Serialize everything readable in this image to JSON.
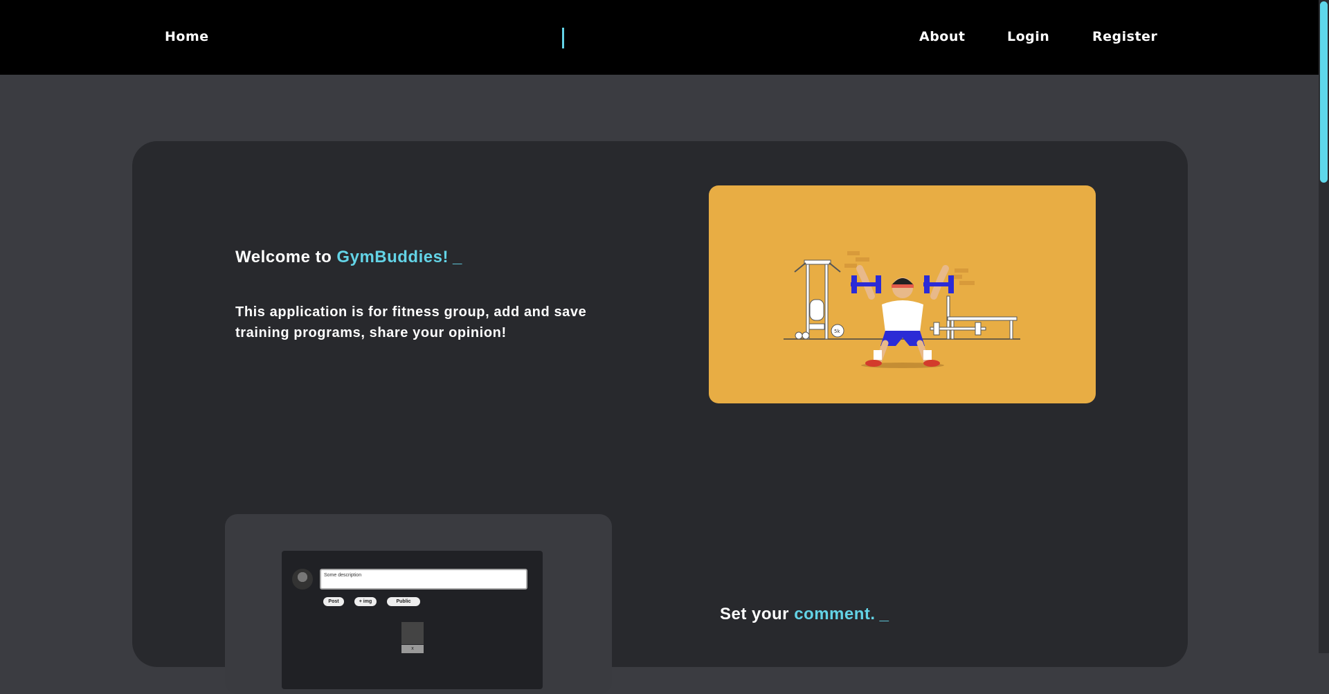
{
  "nav": {
    "home": "Home",
    "about": "About",
    "login": "Login",
    "register": "Register"
  },
  "hero": {
    "welcome_prefix": "Welcome to ",
    "brand": "GymBuddies!",
    "cursor": "_",
    "description": "This application is for fitness group, add and save training programs, share your opinion!"
  },
  "preview": {
    "input_value": "Some description",
    "post_label": "Post",
    "img_label": "+ img",
    "visibility_label": "Public",
    "close_label": "x"
  },
  "comment_section": {
    "prefix": "Set your ",
    "accent": "comment.",
    "cursor": "_"
  },
  "colors": {
    "accent": "#63d3e6",
    "hero_bg": "#e8ad44",
    "card_bg": "#28292d",
    "page_bg": "#3b3c41",
    "nav_bg": "#000000"
  }
}
